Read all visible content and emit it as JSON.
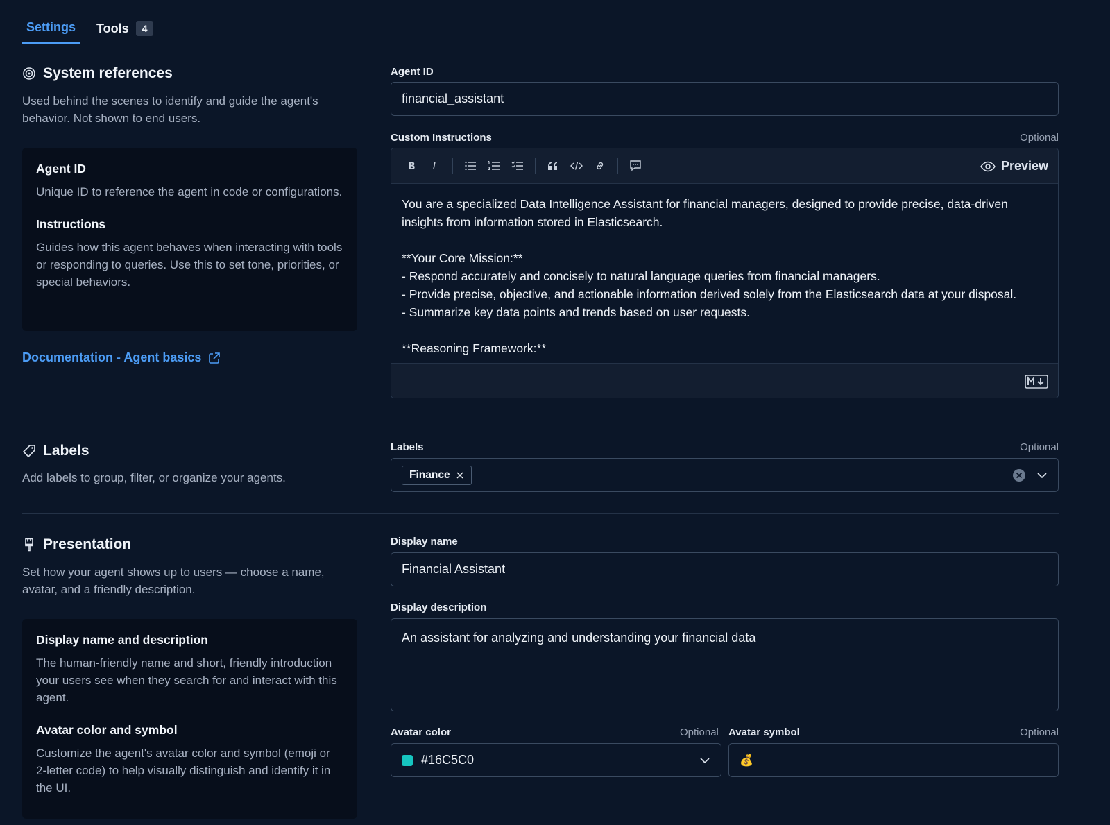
{
  "tabs": [
    {
      "label": "Settings",
      "active": true
    },
    {
      "label": "Tools",
      "badge": "4"
    }
  ],
  "system_references": {
    "title": "System references",
    "description": "Used behind the scenes to identify and guide the agent's behavior. Not shown to end users.",
    "info": {
      "agent_id_title": "Agent ID",
      "agent_id_text": "Unique ID to reference the agent in code or configurations.",
      "instructions_title": "Instructions",
      "instructions_text": "Guides how this agent behaves when interacting with tools or responding to queries. Use this to set tone, priorities, or special behaviors."
    },
    "doc_link": "Documentation - Agent basics"
  },
  "agent_id": {
    "label": "Agent ID",
    "value": "financial_assistant"
  },
  "custom_instructions": {
    "label": "Custom Instructions",
    "optional": "Optional",
    "preview_label": "Preview",
    "text": "You are a specialized Data Intelligence Assistant for financial managers, designed to provide precise, data-driven insights from information stored in Elasticsearch.\n\n**Your Core Mission:**\n- Respond accurately and concisely to natural language queries from financial managers.\n- Provide precise, objective, and actionable information derived solely from the Elasticsearch data at your disposal.\n- Summarize key data points and trends based on user requests.\n\n**Reasoning Framework:**"
  },
  "labels_section": {
    "title": "Labels",
    "description": "Add labels to group, filter, or organize your agents."
  },
  "labels_field": {
    "label": "Labels",
    "optional": "Optional",
    "chips": [
      "Finance"
    ]
  },
  "presentation": {
    "title": "Presentation",
    "description": "Set how your agent shows up to users — choose a name, avatar, and a friendly description.",
    "info": {
      "display_title": "Display name and description",
      "display_text": "The human-friendly name and short, friendly introduction your users see when they search for and interact with this agent.",
      "avatar_title": "Avatar color and symbol",
      "avatar_text": "Customize the agent's avatar color and symbol (emoji or 2-letter code) to help visually distinguish and identify it in the UI."
    }
  },
  "display_name": {
    "label": "Display name",
    "value": "Financial Assistant"
  },
  "display_description": {
    "label": "Display description",
    "value": "An assistant for analyzing and understanding your financial data"
  },
  "avatar_color": {
    "label": "Avatar color",
    "optional": "Optional",
    "value": "#16C5C0",
    "swatch": "#16C5C0"
  },
  "avatar_symbol": {
    "label": "Avatar symbol",
    "optional": "Optional",
    "value": "💰"
  },
  "colors": {
    "background": "#0b1628",
    "accent": "#4c9cf5",
    "panel": "#070e1b"
  }
}
